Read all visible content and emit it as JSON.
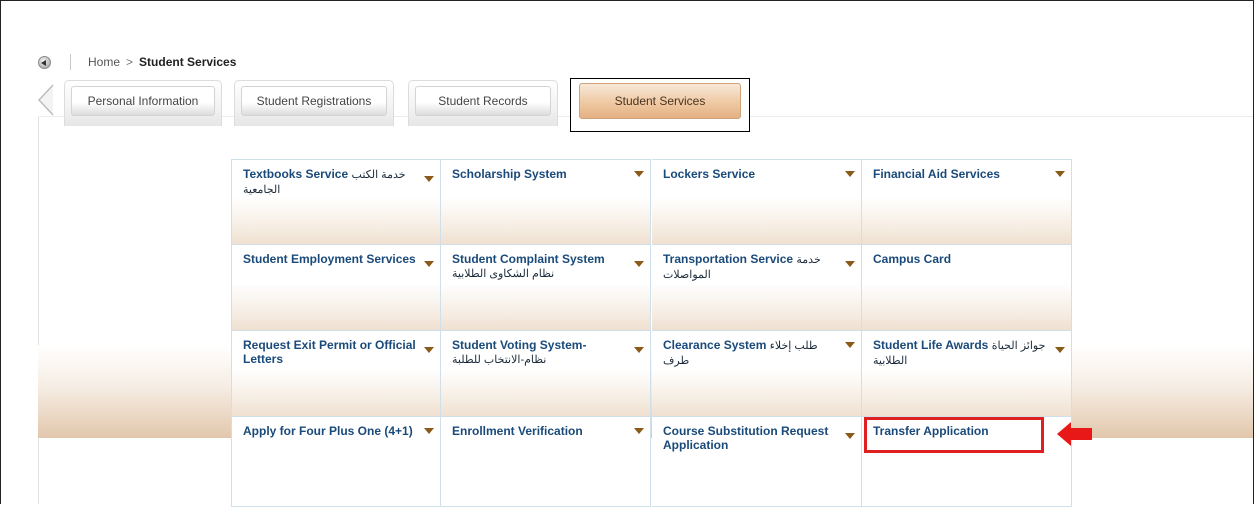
{
  "breadcrumb": {
    "home": "Home",
    "separator": ">",
    "current": "Student Services"
  },
  "tabs": [
    {
      "label": "Personal Information"
    },
    {
      "label": "Student Registrations"
    },
    {
      "label": "Student Records"
    },
    {
      "label": "Student Services",
      "active": true
    }
  ],
  "services": [
    {
      "title": "Textbooks Service",
      "title_ar": "خدمة الكتب الجامعية"
    },
    {
      "title": "Scholarship System",
      "title_ar": ""
    },
    {
      "title": "Lockers Service",
      "title_ar": ""
    },
    {
      "title": "Financial Aid Services",
      "title_ar": ""
    },
    {
      "title": "Student Employment Services",
      "title_ar": ""
    },
    {
      "title": "Student Complaint System",
      "title_ar": "نظام الشكاوى الطلابية"
    },
    {
      "title": "Transportation Service",
      "title_ar": "خدمة المواصلات"
    },
    {
      "title": "Campus Card",
      "title_ar": ""
    },
    {
      "title": "Request Exit Permit or Official Letters",
      "title_ar": ""
    },
    {
      "title": "Student Voting System-",
      "title_ar": "نظام-الانتخاب للطلبة"
    },
    {
      "title": "Clearance System",
      "title_ar": "طلب إخلاء طرف"
    },
    {
      "title": "Student Life Awards",
      "title_ar": "جوائز الحياة الطلابية"
    },
    {
      "title": "Apply for Four Plus One (4+1)",
      "title_ar": ""
    },
    {
      "title": "Enrollment Verification",
      "title_ar": ""
    },
    {
      "title": "Course Substitution Request Application",
      "title_ar": ""
    },
    {
      "title": "Transfer Application",
      "title_ar": "",
      "highlighted": true
    }
  ],
  "colors": {
    "link": "#1a4a7a",
    "caret": "#8a5a18",
    "highlight": "#e02020",
    "active_tab": "#efc9a3"
  },
  "icons": {
    "back": "back-circle-icon",
    "dropdown": "caret-down-icon",
    "annotation": "red-arrow-icon"
  }
}
